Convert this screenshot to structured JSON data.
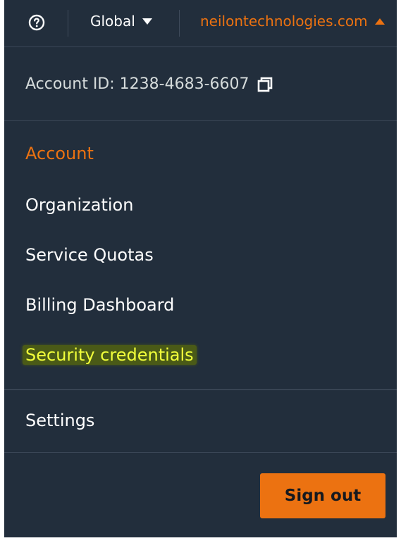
{
  "topbar": {
    "help_icon": "help-circle-icon",
    "region_label": "Global",
    "account_name": "neilontechnologies.com"
  },
  "account": {
    "id_text": "Account ID: 1238-4683-6607",
    "copy_icon": "copy-icon"
  },
  "menu": {
    "items": [
      {
        "label": "Account",
        "active": true
      },
      {
        "label": "Organization"
      },
      {
        "label": "Service Quotas"
      },
      {
        "label": "Billing Dashboard"
      },
      {
        "label": "Security credentials",
        "highlighted": true
      }
    ],
    "settings_label": "Settings",
    "signout_label": "Sign out"
  },
  "colors": {
    "background": "#222e3c",
    "accent": "#ec7211",
    "highlight": "#f1ff3a"
  }
}
